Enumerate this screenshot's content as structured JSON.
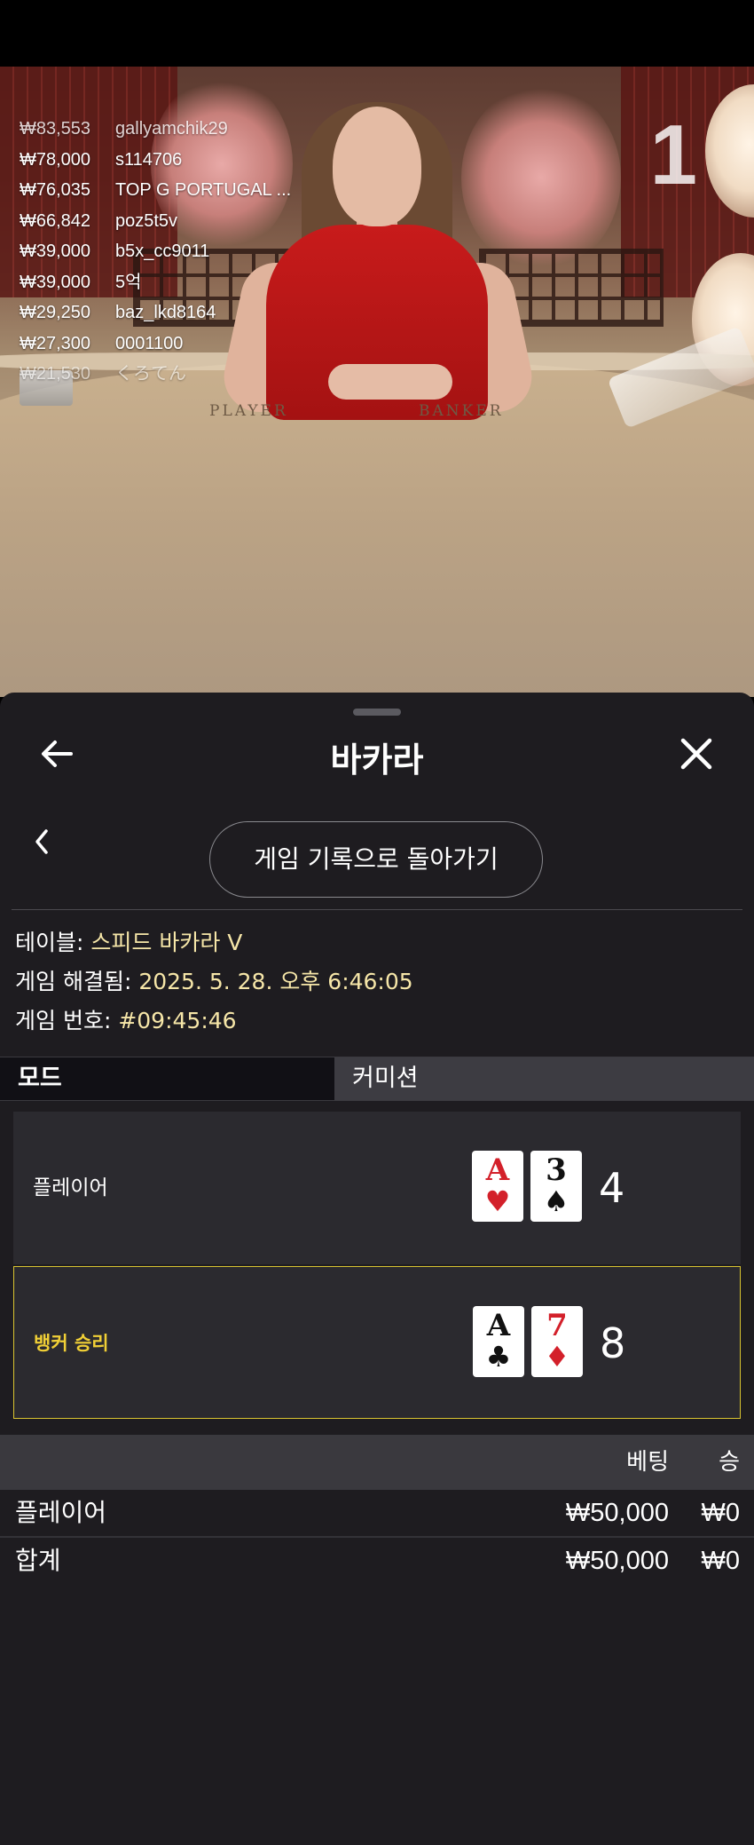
{
  "leaderboard": [
    {
      "amount": "₩83,553",
      "name": "gallyamchik29"
    },
    {
      "amount": "₩78,000",
      "name": "s114706"
    },
    {
      "amount": "₩76,035",
      "name": "TOP G PORTUGAL ..."
    },
    {
      "amount": "₩66,842",
      "name": "poz5t5v"
    },
    {
      "amount": "₩39,000",
      "name": "b5x_cc9011"
    },
    {
      "amount": "₩39,000",
      "name": "5억"
    },
    {
      "amount": "₩29,250",
      "name": "baz_lkd8164"
    },
    {
      "amount": "₩27,300",
      "name": "0001100"
    },
    {
      "amount": "₩21,530",
      "name": "くろてん"
    }
  ],
  "video": {
    "round_counter": "1",
    "table_labels": {
      "player": "PLAYER",
      "banker": "BANKER"
    }
  },
  "sheet": {
    "title": "바카라",
    "history_button": "게임 기록으로 돌아가기",
    "info": {
      "table_label": "테이블: ",
      "table_value": "스피드 바카라 V",
      "resolved_label": "게임 해결됨: ",
      "resolved_value": "2025. 5. 28. 오후 6:46:05",
      "number_label": "게임 번호: ",
      "number_value": "#09:45:46"
    },
    "tabs": {
      "mode": "모드",
      "commission": "커미션"
    },
    "player": {
      "label": "플레이어",
      "cards": [
        {
          "rank": "A",
          "suit": "♥",
          "color": "red"
        },
        {
          "rank": "3",
          "suit": "♠",
          "color": "black"
        }
      ],
      "total": "4"
    },
    "banker": {
      "label": "뱅커 승리",
      "cards": [
        {
          "rank": "A",
          "suit": "♣",
          "color": "black"
        },
        {
          "rank": "7",
          "suit": "♦",
          "color": "red"
        }
      ],
      "total": "8"
    },
    "bets": {
      "header_bet": "베팅",
      "header_win": "승",
      "rows": [
        {
          "label": "플레이어",
          "bet": "₩50,000",
          "win": "₩0"
        },
        {
          "label": "합계",
          "bet": "₩50,000",
          "win": "₩0"
        }
      ]
    }
  },
  "colors": {
    "accent": "#f0cf36",
    "info_value": "#f6e6a8",
    "sheet_bg": "#1e1c20",
    "card_red": "#d3202a"
  },
  "icons": {
    "back": "arrow-left-icon",
    "close": "close-icon",
    "chevron": "chevron-left-icon"
  }
}
